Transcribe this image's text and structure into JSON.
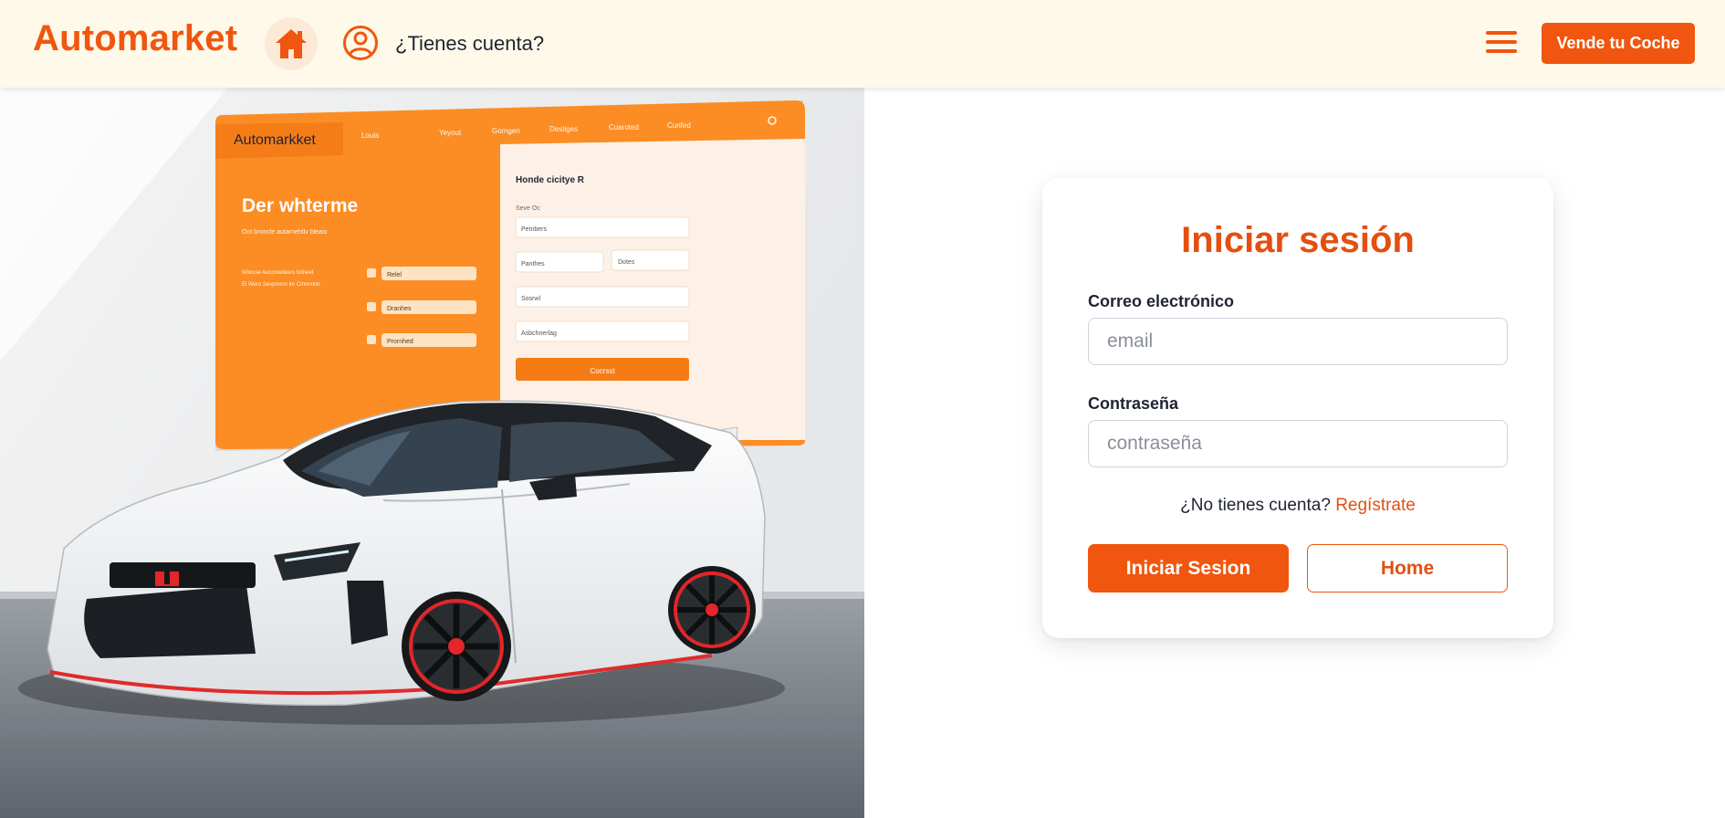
{
  "header": {
    "brand": "Automarket",
    "account_label": "¿Tienes cuenta?",
    "sell_label": "Vende tu Coche",
    "icons": {
      "home": "home-icon",
      "user": "user-circle-icon",
      "menu": "hamburger-menu-icon"
    }
  },
  "hero": {
    "screen": {
      "logo": "Automarkket",
      "nav": [
        "Louis",
        "Yeyout",
        "Gomgen",
        "Destiges",
        "Cuaroted",
        "Cunfed"
      ],
      "headline": "Der whterme",
      "subtitle": "Ont broncle autarnehtlv bleaio",
      "text_lines": [
        "Wlwsse Auconwdeers bdneet",
        "El Wero Sevpnnnn inr Clnnnnnn"
      ],
      "side_items": [
        "Relel",
        "Dranhes",
        "Prornhed"
      ],
      "form_title": "Honde cicitye R",
      "form_sub": "Seve Oc",
      "inputs": [
        "Petnbers",
        "Panthes",
        "Dotes",
        "Sosrwl",
        "Asbchnerlag"
      ],
      "button": "Cocrsst"
    }
  },
  "login": {
    "title": "Iniciar sesión",
    "email_label": "Correo electrónico",
    "email_placeholder": "email",
    "password_label": "Contraseña",
    "password_placeholder": "contraseña",
    "no_account": "¿No tienes cuenta?",
    "register": "Regístrate",
    "submit": "Iniciar Sesion",
    "home": "Home"
  },
  "colors": {
    "accent": "#f0560f",
    "accent_text": "#e44f10",
    "header_bg": "#fef9e8",
    "home_circle": "#fde9d8",
    "screen_orange": "#fb8d24"
  }
}
